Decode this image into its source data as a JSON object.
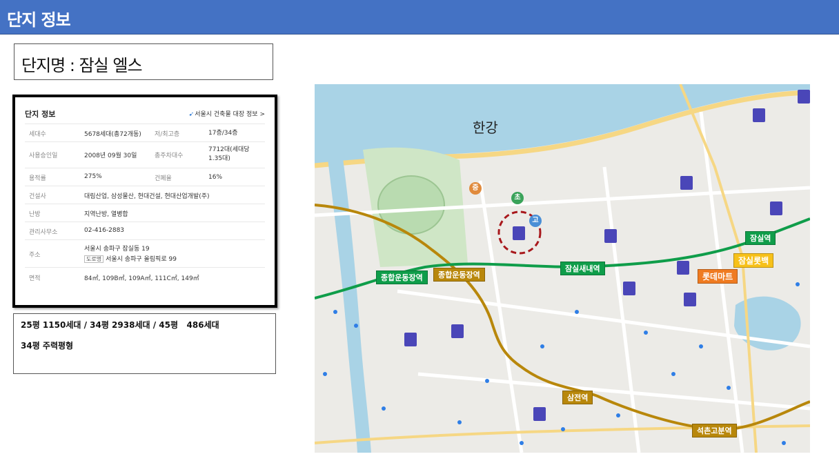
{
  "header": {
    "title": "단지 정보"
  },
  "complex": {
    "name": "단지명 : 잠실 엘스"
  },
  "info_card": {
    "title": "단지 정보",
    "link": "서울시 건축물 대장 정보 >",
    "rows": [
      {
        "label": "세대수",
        "value": "5678세대(총72개동)",
        "label2": "저/최고층",
        "value2": "17층/34층"
      },
      {
        "label": "사용승인일",
        "value": "2008년 09월 30일",
        "label2": "총주차대수",
        "value2": "7712대(세대당 1.35대)"
      },
      {
        "label": "용적률",
        "value": "275%",
        "label2": "건폐율",
        "value2": "16%"
      },
      {
        "label": "건설사",
        "value": "대림산업, 삼성물산, 현대건설, 현대산업개발(주)"
      },
      {
        "label": "난방",
        "value": "지역난방, 열병합"
      },
      {
        "label": "관리사무소",
        "value": "02-416-2883"
      },
      {
        "label": "주소",
        "value": "서울시 송파구 잠실동 19",
        "road_tag": "도로명",
        "value_line2": "서울시 송파구 올림픽로 99"
      },
      {
        "label": "면적",
        "value": "84㎡, 109B㎡, 109A㎡, 111C㎡, 149㎡"
      }
    ]
  },
  "summary": {
    "line1": "25평 1150세대 / 34평 2938세대 / 45평   486세대",
    "line2": "34평 주력평형"
  },
  "map": {
    "river": "한강",
    "stations": {
      "sports_complex_green": "종합운동장역",
      "sports_complex_gold": "종합운동장역",
      "jamsil_saenae": "잠실새내역",
      "jamsil": "잠실역",
      "samjeon": "삼전역",
      "seokchon_gobun": "석촌고분역"
    },
    "landmarks": {
      "lotte_mart": "롯데마트",
      "lotte_world": "잠실롯백"
    },
    "school_badges": {
      "middle": "중",
      "elementary": "초",
      "high": "고"
    },
    "colors": {
      "line2": "#0f9d4a",
      "line9": "#b8870b",
      "highlight": "#a8181c"
    }
  }
}
